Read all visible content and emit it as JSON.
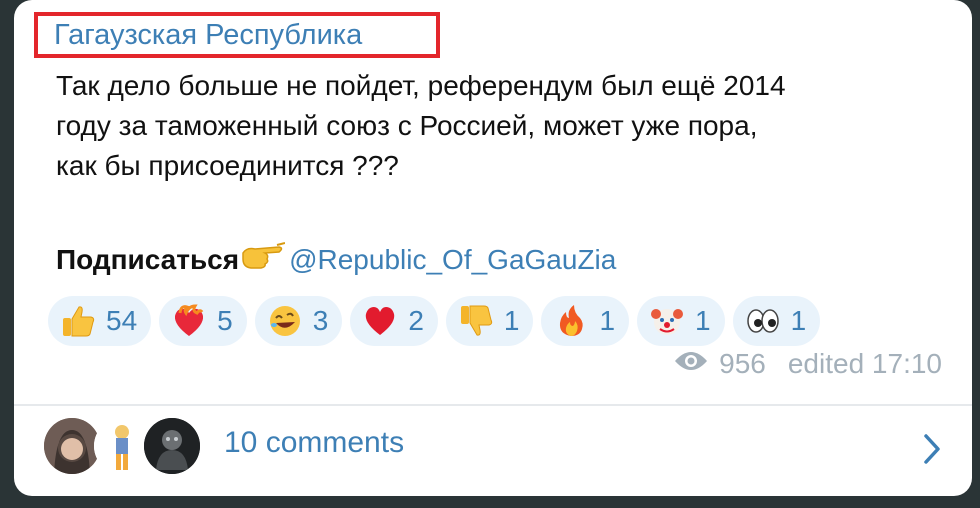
{
  "post": {
    "channel_name": "Гагаузская Республика",
    "text_lines": [
      "Так дело больше не пойдет, референдум был ещё 2014",
      "году за таможенный союз с Россией, может уже пора,",
      "как бы присоединится ???"
    ],
    "subscribe_label": "Подписаться",
    "subscribe_link": "@Republic_Of_GaGauZia",
    "views": "956",
    "edited": "edited 17:10"
  },
  "reactions": [
    {
      "emoji": "thumbs-up-icon",
      "count": "54"
    },
    {
      "emoji": "heart-on-fire-icon",
      "count": "5"
    },
    {
      "emoji": "rolling-on-floor-laughing-icon",
      "count": "3"
    },
    {
      "emoji": "red-heart-icon",
      "count": "2"
    },
    {
      "emoji": "thumbs-down-icon",
      "count": "1"
    },
    {
      "emoji": "fire-icon",
      "count": "1"
    },
    {
      "emoji": "clown-face-icon",
      "count": "1"
    },
    {
      "emoji": "eyes-icon",
      "count": "1"
    }
  ],
  "comments": {
    "label": "10 comments"
  },
  "colors": {
    "link_blue": "#3d7fb5",
    "reaction_bg": "#e9f3fb",
    "highlight_red": "#e3262b",
    "meta_gray": "#a4b0ba"
  }
}
